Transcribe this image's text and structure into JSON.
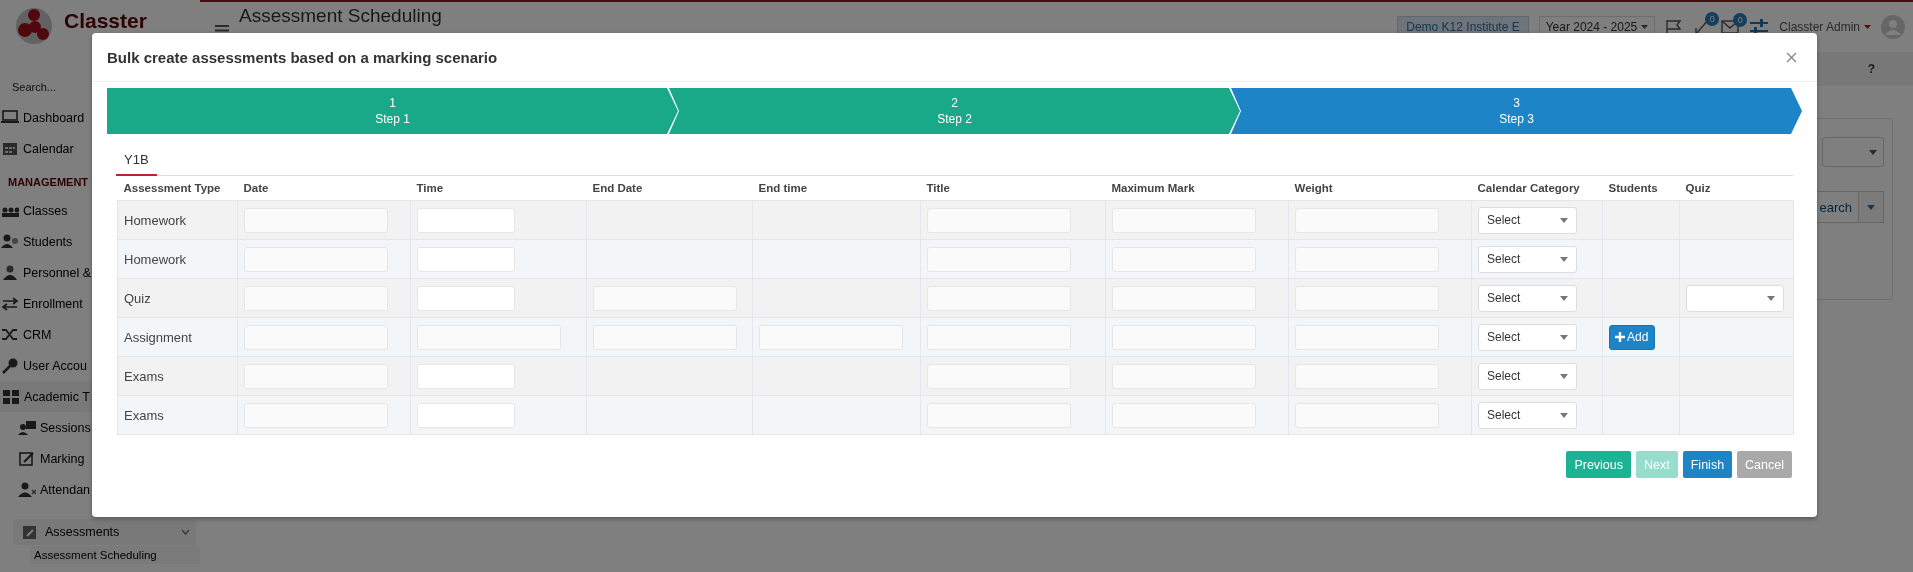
{
  "app": {
    "logo_text": "Classter",
    "search_placeholder": "Search...",
    "page_title": "Assessment Scheduling",
    "institute": "Demo K12 Institute E",
    "year": "Year 2024 - 2025",
    "notification_count": "0",
    "message_count": "0",
    "user": "Classter Admin",
    "help": "?",
    "search_button": "earch"
  },
  "sidebar": {
    "items": [
      {
        "label": "Dashboard",
        "kind": "link"
      },
      {
        "label": "Calendar",
        "kind": "link"
      },
      {
        "label": "MANAGEMENT",
        "kind": "heading"
      },
      {
        "label": "Classes",
        "kind": "link"
      },
      {
        "label": "Students",
        "kind": "link"
      },
      {
        "label": "Personnel &",
        "kind": "link"
      },
      {
        "label": "Enrollment",
        "kind": "link"
      },
      {
        "label": "CRM",
        "kind": "link"
      },
      {
        "label": "User Accou",
        "kind": "link"
      },
      {
        "label": "Academic T",
        "kind": "group"
      },
      {
        "label": "Sessions",
        "kind": "sub"
      },
      {
        "label": "Marking",
        "kind": "sub"
      },
      {
        "label": "Attendan",
        "kind": "sub"
      },
      {
        "label": "Assessments",
        "kind": "section",
        "expanded": true
      },
      {
        "label": "Assessment Scheduling",
        "kind": "child"
      }
    ]
  },
  "modal": {
    "title": "Bulk create assessments based on a marking scenario",
    "steps": [
      {
        "number": "1",
        "label": "Step 1",
        "current": false
      },
      {
        "number": "2",
        "label": "Step 2",
        "current": false
      },
      {
        "number": "3",
        "label": "Step 3",
        "current": true
      }
    ],
    "tabs": [
      {
        "label": "Y1B",
        "selected": true
      }
    ],
    "table": {
      "columns": [
        "Assessment Type",
        "Date",
        "Time",
        "End Date",
        "End time",
        "Title",
        "Maximum Mark",
        "Weight",
        "Calendar Category",
        "Students",
        "Quiz"
      ],
      "rows": [
        {
          "type": "Homework",
          "fields": {
            "date": {
              "kind": "box"
            },
            "time": {
              "kind": "picker"
            },
            "title": {
              "kind": "box"
            },
            "maximum_mark": {
              "kind": "box"
            },
            "weight": {
              "kind": "box"
            }
          },
          "category": "Select"
        },
        {
          "type": "Homework",
          "fields": {
            "date": {
              "kind": "box"
            },
            "time": {
              "kind": "picker"
            },
            "title": {
              "kind": "box"
            },
            "maximum_mark": {
              "kind": "box"
            },
            "weight": {
              "kind": "box"
            }
          },
          "category": "Select"
        },
        {
          "type": "Quiz",
          "fields": {
            "date": {
              "kind": "box"
            },
            "time": {
              "kind": "picker"
            },
            "end_date": {
              "kind": "box"
            },
            "title": {
              "kind": "box"
            },
            "maximum_mark": {
              "kind": "box"
            },
            "weight": {
              "kind": "box"
            }
          },
          "category": "Select",
          "quiz_select": true
        },
        {
          "type": "Assignment",
          "fields": {
            "date": {
              "kind": "box"
            },
            "time": {
              "kind": "box"
            },
            "end_date": {
              "kind": "box"
            },
            "end_time": {
              "kind": "box"
            },
            "title": {
              "kind": "box"
            },
            "maximum_mark": {
              "kind": "box"
            },
            "weight": {
              "kind": "box"
            }
          },
          "category": "Select",
          "students_button": "Add"
        },
        {
          "type": "Exams",
          "fields": {
            "date": {
              "kind": "box"
            },
            "time": {
              "kind": "picker"
            },
            "title": {
              "kind": "box"
            },
            "maximum_mark": {
              "kind": "box"
            },
            "weight": {
              "kind": "box"
            }
          },
          "category": "Select"
        },
        {
          "type": "Exams",
          "fields": {
            "date": {
              "kind": "box"
            },
            "time": {
              "kind": "picker"
            },
            "title": {
              "kind": "box"
            },
            "maximum_mark": {
              "kind": "box"
            },
            "weight": {
              "kind": "box"
            }
          },
          "category": "Select"
        }
      ]
    },
    "buttons": [
      {
        "label": "Previous",
        "kind": "back",
        "disabled": false
      },
      {
        "label": "Next",
        "kind": "forward",
        "disabled": true
      },
      {
        "label": "Finish",
        "kind": "primary",
        "disabled": false
      },
      {
        "label": "Cancel",
        "kind": "cancel",
        "disabled": true
      }
    ]
  }
}
